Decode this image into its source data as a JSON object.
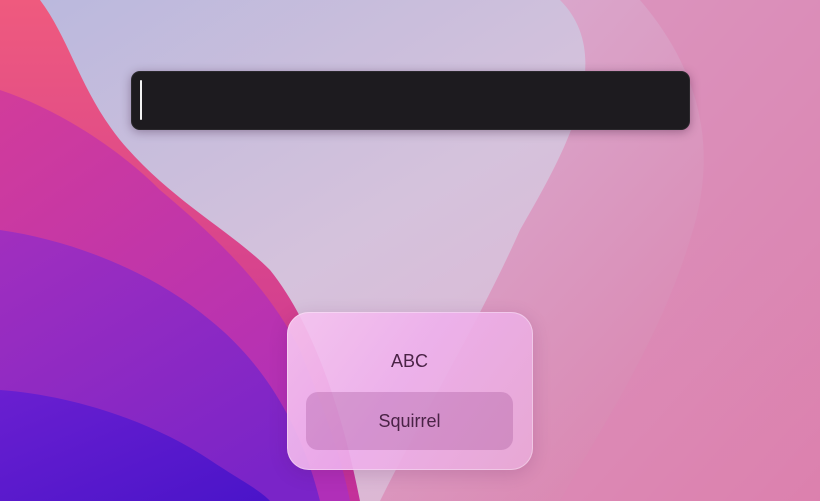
{
  "search": {
    "value": "",
    "placeholder": ""
  },
  "input_switcher": {
    "items": [
      {
        "label": "ABC",
        "selected": false
      },
      {
        "label": "Squirrel",
        "selected": true
      }
    ]
  },
  "colors": {
    "search_bg": "#1d1b1f",
    "switcher_bg": "#f3c2ee",
    "selected_item_bg": "#c98ac2",
    "item_text": "#4a2346"
  }
}
